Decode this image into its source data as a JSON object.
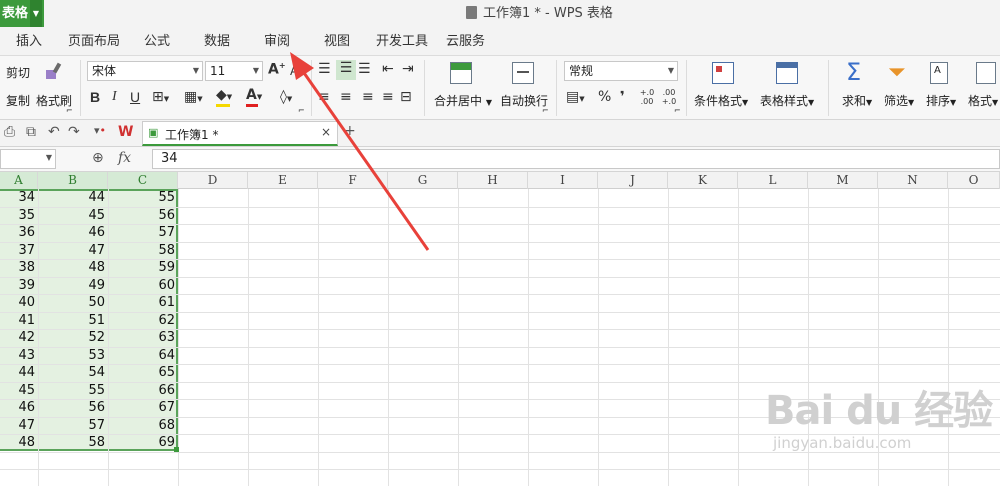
{
  "titlebar": {
    "app_badge": "表格",
    "doc_title": "工作簿1 * - WPS 表格"
  },
  "menu": {
    "tabs": [
      "插入",
      "页面布局",
      "公式",
      "数据",
      "审阅",
      "视图",
      "开发工具",
      "云服务"
    ]
  },
  "ribbon": {
    "cut": "剪切",
    "copy": "复制",
    "format_painter": "格式刷",
    "font_name": "宋体",
    "font_size": "11",
    "bold": "B",
    "italic": "I",
    "underline": "U",
    "merge_center": "合并居中",
    "wrap_text": "自动换行",
    "number_format": "常规",
    "percent": "%",
    "thousands": "❜",
    "inc_decimal": "+.0 .00",
    "dec_decimal": ".00 +.0",
    "conditional_format": "条件格式",
    "table_style": "表格样式",
    "sum": "求和",
    "filter": "筛选",
    "sort": "排序",
    "format": "格式"
  },
  "tabs": {
    "doc_tab": "工作簿1 *",
    "close": "×",
    "add": "+"
  },
  "formula_bar": {
    "name_box": "",
    "fx": "fx",
    "value": "34"
  },
  "grid": {
    "columns": [
      "A",
      "B",
      "C",
      "D",
      "E",
      "F",
      "G",
      "H",
      "I",
      "J",
      "K",
      "L",
      "M",
      "N",
      "O"
    ],
    "rows": [
      [
        "34",
        "44",
        "55"
      ],
      [
        "35",
        "45",
        "56"
      ],
      [
        "36",
        "46",
        "57"
      ],
      [
        "37",
        "47",
        "58"
      ],
      [
        "38",
        "48",
        "59"
      ],
      [
        "39",
        "49",
        "60"
      ],
      [
        "40",
        "50",
        "61"
      ],
      [
        "41",
        "51",
        "62"
      ],
      [
        "42",
        "52",
        "63"
      ],
      [
        "43",
        "53",
        "64"
      ],
      [
        "44",
        "54",
        "65"
      ],
      [
        "45",
        "55",
        "66"
      ],
      [
        "46",
        "56",
        "67"
      ],
      [
        "47",
        "57",
        "68"
      ],
      [
        "48",
        "58",
        "69"
      ]
    ]
  },
  "watermark": {
    "logo": "Bai du 经验",
    "url": "jingyan.baidu.com"
  },
  "colors": {
    "accent": "#3c9a3c",
    "selection_fill": "#e4f1e1",
    "arrow": "#e8413a"
  }
}
